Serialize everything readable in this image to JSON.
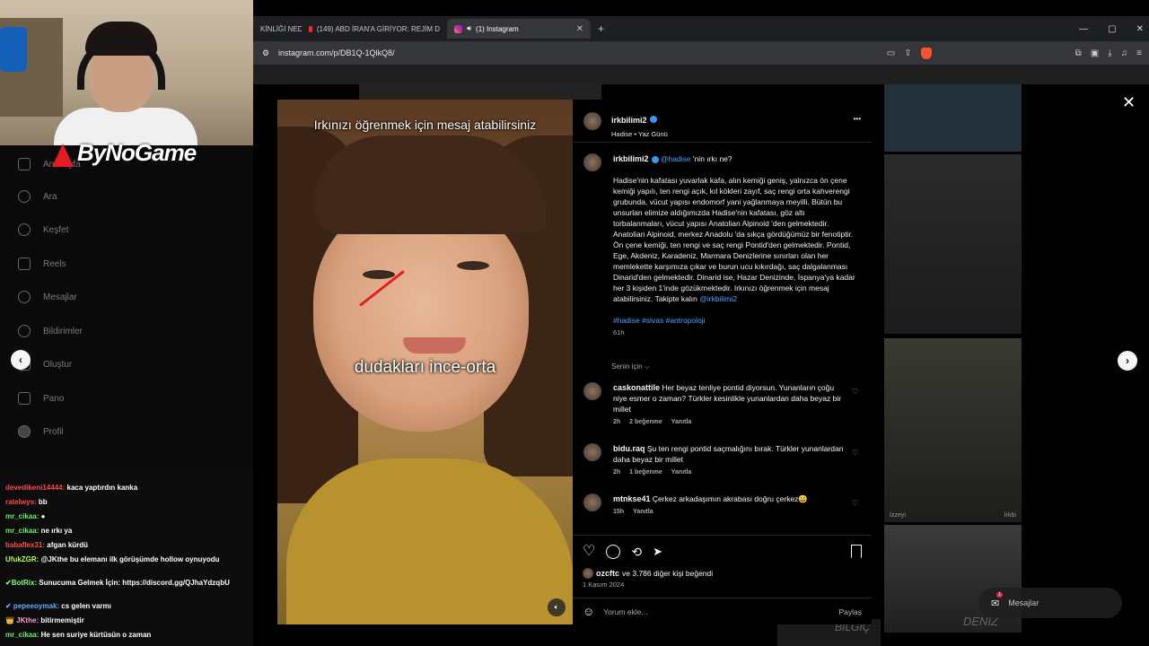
{
  "browser": {
    "tabs": [
      {
        "label": "KİNLİĞİ NEDİ",
        "icon": "none"
      },
      {
        "label": "(149) ABD İRAN'A GİRİYOR: REJİM D",
        "icon": "youtube-icon"
      },
      {
        "label": "(1) Instagram",
        "icon": "instagram-icon",
        "active": true
      }
    ],
    "new_tab": "+",
    "url": "instagram.com/p/DB1Q-1QlkQ8/",
    "window_controls": [
      "—",
      "▢",
      "✕"
    ]
  },
  "stream": {
    "channel_logo": "ByNoGame"
  },
  "sidebar": {
    "items": [
      {
        "label": "Anasayfa",
        "icon": "home-icon"
      },
      {
        "label": "Ara",
        "icon": "search-icon"
      },
      {
        "label": "Keşfet",
        "icon": "compass-icon"
      },
      {
        "label": "Reels",
        "icon": "reels-icon"
      },
      {
        "label": "Mesajlar",
        "icon": "messenger-icon"
      },
      {
        "label": "Bildirimler",
        "icon": "heart-icon"
      },
      {
        "label": "Oluştur",
        "icon": "plus-icon"
      },
      {
        "label": "Pano",
        "icon": "dashboard-icon"
      },
      {
        "label": "Profil",
        "icon": "profile-icon"
      }
    ]
  },
  "chat": {
    "lines": [
      {
        "user": "devedikeni14444:",
        "text": "kaca yaptırdın kanka",
        "color": "#ff4b4b"
      },
      {
        "user": "ratelwys:",
        "text": "bb",
        "color": "#ff4b4b"
      },
      {
        "user": "mr_cikaa:",
        "text": "●",
        "color": "#6bf06b"
      },
      {
        "user": "mr_cikaa:",
        "text": "ne ırkı ya",
        "color": "#6bf06b"
      },
      {
        "user": "babaflex31:",
        "text": "afgan kürdü",
        "color": "#ff4b4b"
      },
      {
        "user": "UfukZGR:",
        "text": "@JKthe bu elemanı ilk görüşümde hollow oynuyodu",
        "color": "#b7ff4a"
      },
      {
        "user": "✔BotRix:",
        "text": "Sunucuma Gelmek İçin: https://discord.gg/QJhaYdzqbU",
        "color": "#7cff7c"
      },
      {
        "user": "✔ pepeeoymak:",
        "text": "cs gelen varmı",
        "color": "#6aa8ff"
      },
      {
        "user": "👑 JKthe:",
        "text": "bitirmemiştir",
        "color": "#ff9ad5"
      },
      {
        "user": "mr_cikaa:",
        "text": "He sen suriye kürtüsün o zaman",
        "color": "#6bf06b"
      }
    ]
  },
  "post": {
    "image_text_top": "Irkınızı öğrenmek için mesaj atabilirsiniz",
    "image_text_mid": "dudakları ince-orta",
    "author": "irkbilimi2",
    "audio": "Hadise • Yaz Günü",
    "more": "•••",
    "caption_author": "irkbilimi2",
    "caption_mention": "@hadise",
    "caption_title_rest": "'nin ırkı ne?",
    "caption_body": "Hadise'nin kafatası yuvarlak kafa, alın kemiği geniş, yalnızca ön çene kemiği yapılı, ten rengi açık, kıl kökleri zayıf, saç rengi orta kahverengi grubunda, vücut yapısı endomorf yani yağlanmaya meyilli. Bütün bu unsurlan elimize aldığımızda Hadise'nin kafatası, göz altı torbalanmaları, vücut yapısı Anatolian Alpinoid 'den gelmektedir. Anatolian Alpinoid, merkez Anadolu 'da sıkça gördüğümüz bir fenotiptir. Ön çene kemiği, ten rengi ve saç rengi Pontid'den gelmektedir. Pontid, Ege, Akdeniz, Karadeniz, Marmara Denizlerine sınırları olan her memlekette karşımıza çıkar ve burun ucu kıkırdağı, saç dalgalanması Dinarid'den gelmektedir. Dinarid ise, Hazar Denizinde, İspanya'ya kadar her 3 kişiden 1'inde gözükmektedir. Irkınızı öğrenmek için mesaj atabilirsiniz. Takipte kalın",
    "caption_follow": "@irkbilimi2",
    "hashtags": "#hadise #sivas #antropoloji",
    "caption_time": "61h",
    "sort_label": "Senin için ⌵",
    "comments": [
      {
        "user": "caskonattile",
        "text": "Her beyaz tenliye pontid diyorsun. Yunanların çoğu niye esmer o zaman? Türkler kesinlikle yunanlardan daha beyaz bir millet",
        "time": "2h",
        "likes": "2 beğenme",
        "reply": "Yanıtla"
      },
      {
        "user": "bidu.raq",
        "text": "Şu ten rengi pontid saçmalığını bırak. Türkler yunanlardan daha beyaz bir millet",
        "time": "2h",
        "likes": "1 beğenme",
        "reply": "Yanıtla"
      },
      {
        "user": "mtnkse41",
        "text": "Çerkez arkadaşımın akrabası doğru çerkez😀",
        "time": "15h",
        "likes": "",
        "reply": "Yanıtla"
      }
    ],
    "liked_by_user": "ozcftc",
    "liked_by_rest": "ve 3.786 diğer kişi beğendi",
    "date": "1 Kasım 2024",
    "comment_placeholder": "Yorum ekle...",
    "share_label": "Paylaş"
  },
  "overlay": {
    "close": "✕",
    "prev": "‹",
    "next": "›",
    "messages_label": "Mesajlar",
    "messages_badge": "1"
  },
  "background_tiles": {
    "labels": [
      "İzzeyi",
      "İrkbi",
      "DENİZ",
      "BİLGİÇ"
    ]
  }
}
